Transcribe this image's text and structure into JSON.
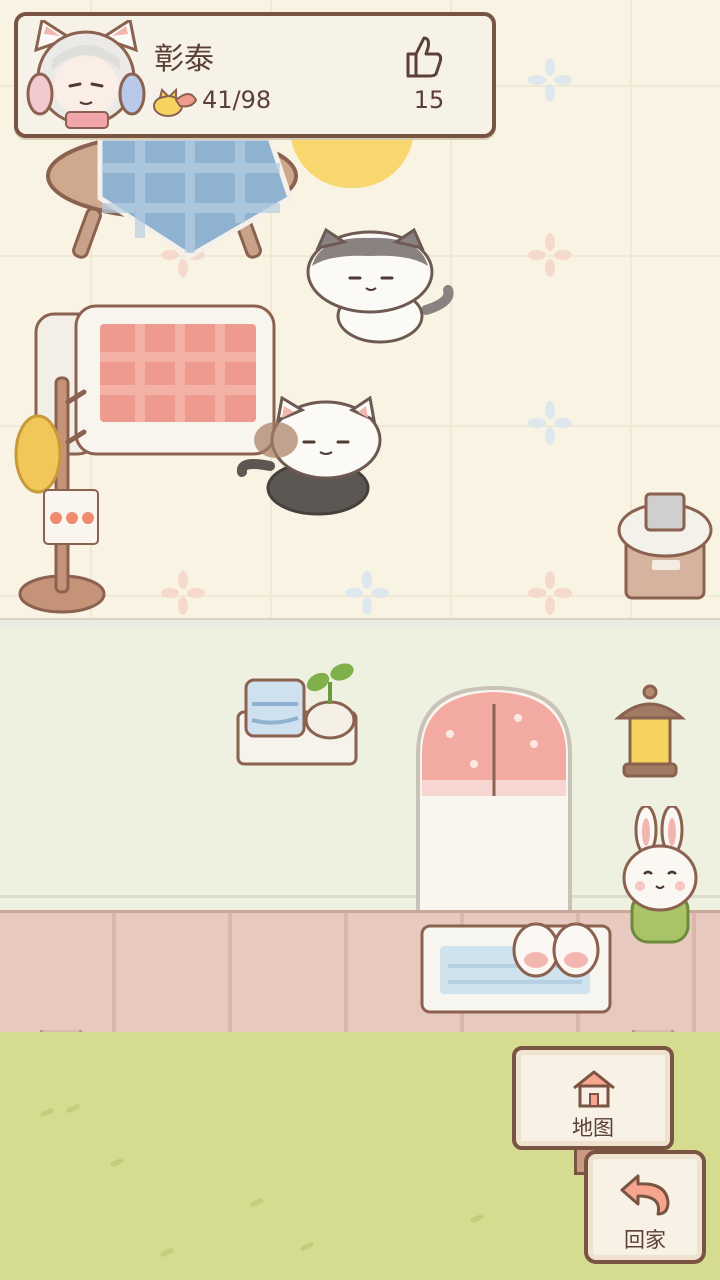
{
  "player": {
    "name": "彰泰",
    "shrimp": "41/98",
    "likes": "15"
  },
  "buttons": {
    "map_label": "地图",
    "home_label": "回家"
  },
  "colors": {
    "outline": "#7a5443",
    "text": "#5b4035",
    "wall": "#f8f3e3",
    "grass": "#d6dc8f",
    "deck": "#e8c9bf"
  },
  "icons": [
    "thumbs-up-icon",
    "shrimp-icon",
    "house-icon",
    "return-arrow-icon"
  ]
}
